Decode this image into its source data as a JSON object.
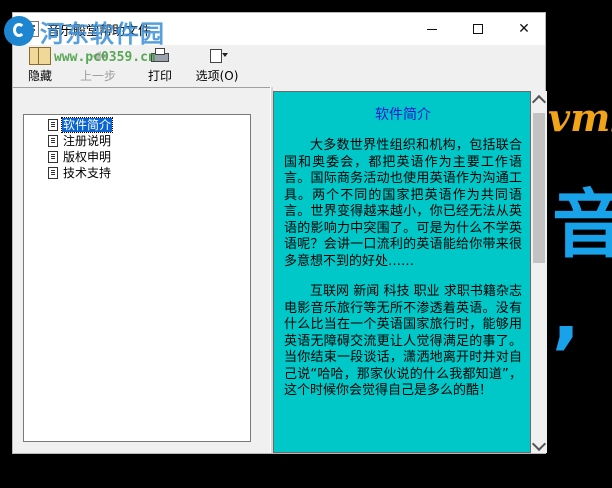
{
  "window": {
    "title": "音乐殿堂帮助文件",
    "controls": {
      "minimize": "minimize",
      "maximize": "maximize",
      "close": "✕"
    }
  },
  "toolbar": {
    "hide_label": "隐藏",
    "back_label": "上一步",
    "print_label": "打印",
    "options_label": "选项(O)"
  },
  "tree": {
    "items": [
      {
        "label": "软件简介",
        "selected": true
      },
      {
        "label": "注册说明"
      },
      {
        "label": "版权申明"
      },
      {
        "label": "技术支持"
      }
    ]
  },
  "content": {
    "title": "软件简介",
    "paragraphs": [
      "大多数世界性组织和机构，包括联合国和奥委会，都把英语作为主要工作语言。国际商务活动也使用英语作为沟通工具。两个不同的国家把英语作为共同语言。世界变得越来越小，你已经无法从英语的影响力中突围了。可是为什么不学英语呢？会讲一口流利的英语能给你带来很多意想不到的好处……",
      "互联网 新闻 科技 职业 求职书籍杂志电影音乐旅行等无所不渗透着英语。没有什么比当在一个英语国家旅行时，能够用英语无障碍交流更让人觉得满足的事了。当你结束一段谈话，潇洒地离开时并对自己说“哈哈，那家伙说的什么我都知道”，这个时候你会觉得自己是多么的酷！"
    ]
  },
  "background": {
    "text_1": "vmb",
    "text_2": "音 ,"
  },
  "watermark": {
    "title": "河东软件园",
    "url": "www.pc0359.cn"
  },
  "colors": {
    "content_bg": "#00c8c8",
    "content_title": "#1a1acb",
    "selection": "#0a64d2"
  }
}
